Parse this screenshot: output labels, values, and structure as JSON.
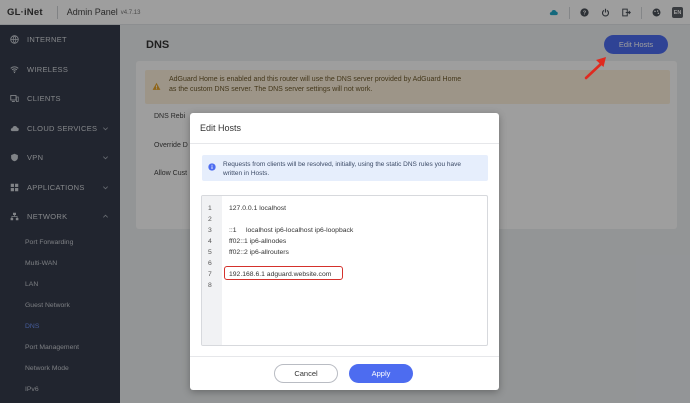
{
  "header": {
    "logo": "GL·iNet",
    "panel_title": "Admin Panel",
    "version": "v4.7.13",
    "lang": "EN",
    "icons": [
      "cloud-icon",
      "help-icon",
      "power-icon",
      "logout-icon",
      "theme-icon",
      "language-icon"
    ],
    "accent": "#4d6cf0"
  },
  "sidebar": {
    "items": [
      {
        "label": "INTERNET",
        "icon": "globe-icon"
      },
      {
        "label": "WIRELESS",
        "icon": "wifi-icon"
      },
      {
        "label": "CLIENTS",
        "icon": "devices-icon"
      },
      {
        "label": "CLOUD SERVICES",
        "icon": "cloud-icon"
      },
      {
        "label": "VPN",
        "icon": "shield-icon"
      },
      {
        "label": "APPLICATIONS",
        "icon": "grid-icon"
      },
      {
        "label": "NETWORK",
        "icon": "network-icon"
      }
    ],
    "network_sub": [
      {
        "label": "Port Forwarding"
      },
      {
        "label": "Multi-WAN"
      },
      {
        "label": "LAN"
      },
      {
        "label": "Guest Network"
      },
      {
        "label": "DNS",
        "active": true
      },
      {
        "label": "Port Management"
      },
      {
        "label": "Network Mode"
      },
      {
        "label": "IPv6"
      }
    ]
  },
  "main": {
    "title": "DNS",
    "edit_hosts_label": "Edit Hosts",
    "warning": "AdGuard Home is enabled and this router will use the DNS server provided by AdGuard Home as the custom DNS server. The DNS server settings will not work.",
    "rows": [
      "DNS Rebi",
      "Override D",
      "Allow Cust"
    ]
  },
  "dialog": {
    "title": "Edit Hosts",
    "info": "Requests from clients will be resolved, initially, using the static DNS rules you have written in Hosts.",
    "lines": [
      {
        "n": "1",
        "text": "127.0.0.1 localhost"
      },
      {
        "n": "2",
        "text": ""
      },
      {
        "n": "3",
        "text": "::1     localhost ip6-localhost ip6-loopback"
      },
      {
        "n": "4",
        "text": "ff02::1 ip6-allnodes"
      },
      {
        "n": "5",
        "text": "ff02::2 ip6-allrouters"
      },
      {
        "n": "6",
        "text": ""
      },
      {
        "n": "7",
        "text": "192.168.6.1 adguard.website.com"
      },
      {
        "n": "8",
        "text": ""
      }
    ],
    "cancel_label": "Cancel",
    "apply_label": "Apply"
  }
}
